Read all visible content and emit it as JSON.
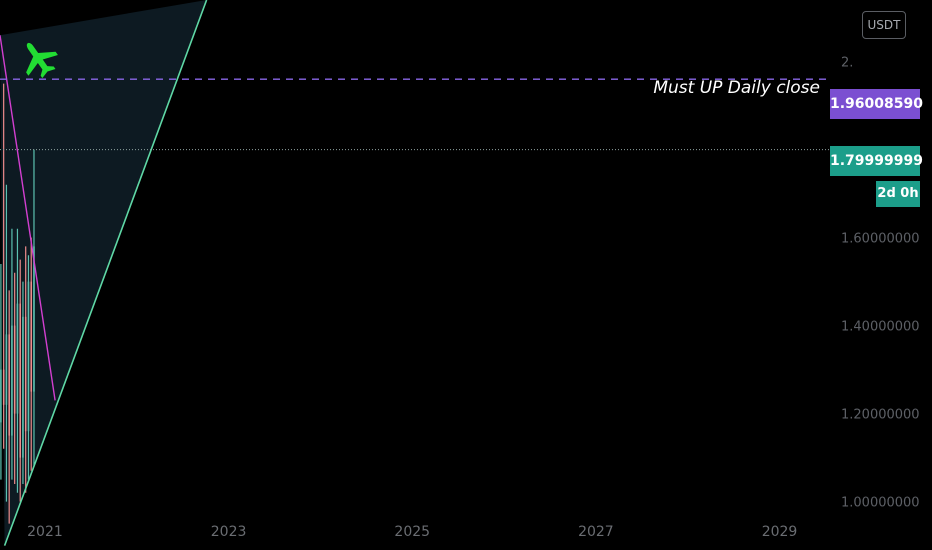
{
  "chart_data": {
    "type": "candlestick",
    "symbol_currency": "USDT",
    "y_axis": {
      "ticks": [
        1.0,
        1.2,
        1.4,
        1.6,
        2.0
      ],
      "tick_labels": [
        "1.00000000",
        "1.20000000",
        "1.40000000",
        "1.60000000",
        "2."
      ],
      "ylim": [
        0.89,
        2.14
      ]
    },
    "x_axis": {
      "tick_labels": [
        "2021",
        "2023",
        "2025",
        "2027",
        "2029"
      ],
      "ticks": [
        2021.0,
        2023.0,
        2025.0,
        2027.0,
        2029.0
      ],
      "xlim": [
        2020.75,
        2030.9
      ]
    },
    "candles": [
      {
        "x": 2020.76,
        "open": 1.18,
        "high": 1.54,
        "low": 1.05,
        "close": 1.3
      },
      {
        "x": 2020.79,
        "open": 1.3,
        "high": 1.95,
        "low": 1.12,
        "close": 1.22
      },
      {
        "x": 2020.82,
        "open": 1.22,
        "high": 1.72,
        "low": 1.0,
        "close": 1.38
      },
      {
        "x": 2020.85,
        "open": 1.38,
        "high": 1.48,
        "low": 0.95,
        "close": 1.15
      },
      {
        "x": 2020.88,
        "open": 1.15,
        "high": 1.62,
        "low": 1.05,
        "close": 1.4
      },
      {
        "x": 2020.91,
        "open": 1.4,
        "high": 1.52,
        "low": 1.04,
        "close": 1.2
      },
      {
        "x": 2020.94,
        "open": 1.2,
        "high": 1.62,
        "low": 1.02,
        "close": 1.45
      },
      {
        "x": 2020.97,
        "open": 1.45,
        "high": 1.55,
        "low": 1.0,
        "close": 1.1
      },
      {
        "x": 2021.0,
        "open": 1.1,
        "high": 1.5,
        "low": 1.04,
        "close": 1.42
      },
      {
        "x": 2021.03,
        "open": 1.42,
        "high": 1.58,
        "low": 1.02,
        "close": 1.16
      },
      {
        "x": 2021.06,
        "open": 1.16,
        "high": 1.56,
        "low": 1.05,
        "close": 1.5
      },
      {
        "x": 2021.09,
        "open": 1.5,
        "high": 1.6,
        "low": 1.07,
        "close": 1.25
      },
      {
        "x": 2021.12,
        "open": 1.25,
        "high": 1.8,
        "low": 1.08,
        "close": 1.58
      }
    ],
    "lines": {
      "current_price": 1.79999999,
      "resistance": 1.9600859,
      "ascending_trendline": [
        [
          2020.8,
          0.9
        ],
        [
          2023.0,
          2.14
        ]
      ],
      "descending_trendline": [
        [
          2020.75,
          2.06
        ],
        [
          2021.35,
          1.23
        ]
      ]
    },
    "annotation_text": "Must UP Daily close",
    "labels": {
      "resistance_price": "1.96008590",
      "current_price": "1.79999999",
      "countdown": "2d 0h"
    },
    "colors": {
      "background": "#000000",
      "grid": "#151515",
      "up_candle": "#5bc0b0",
      "down_candle": "#f08c8c",
      "ascending_trendline": "#5fd8a6",
      "descending_trendline": "#d23fd0",
      "resistance_line": "#8a67e8",
      "current_price_line": "#8fa3a0",
      "triangle_fill": "#0d1a22",
      "airplane": "#22dd33"
    },
    "airplane_icon": "airplane-icon",
    "grid": false
  }
}
